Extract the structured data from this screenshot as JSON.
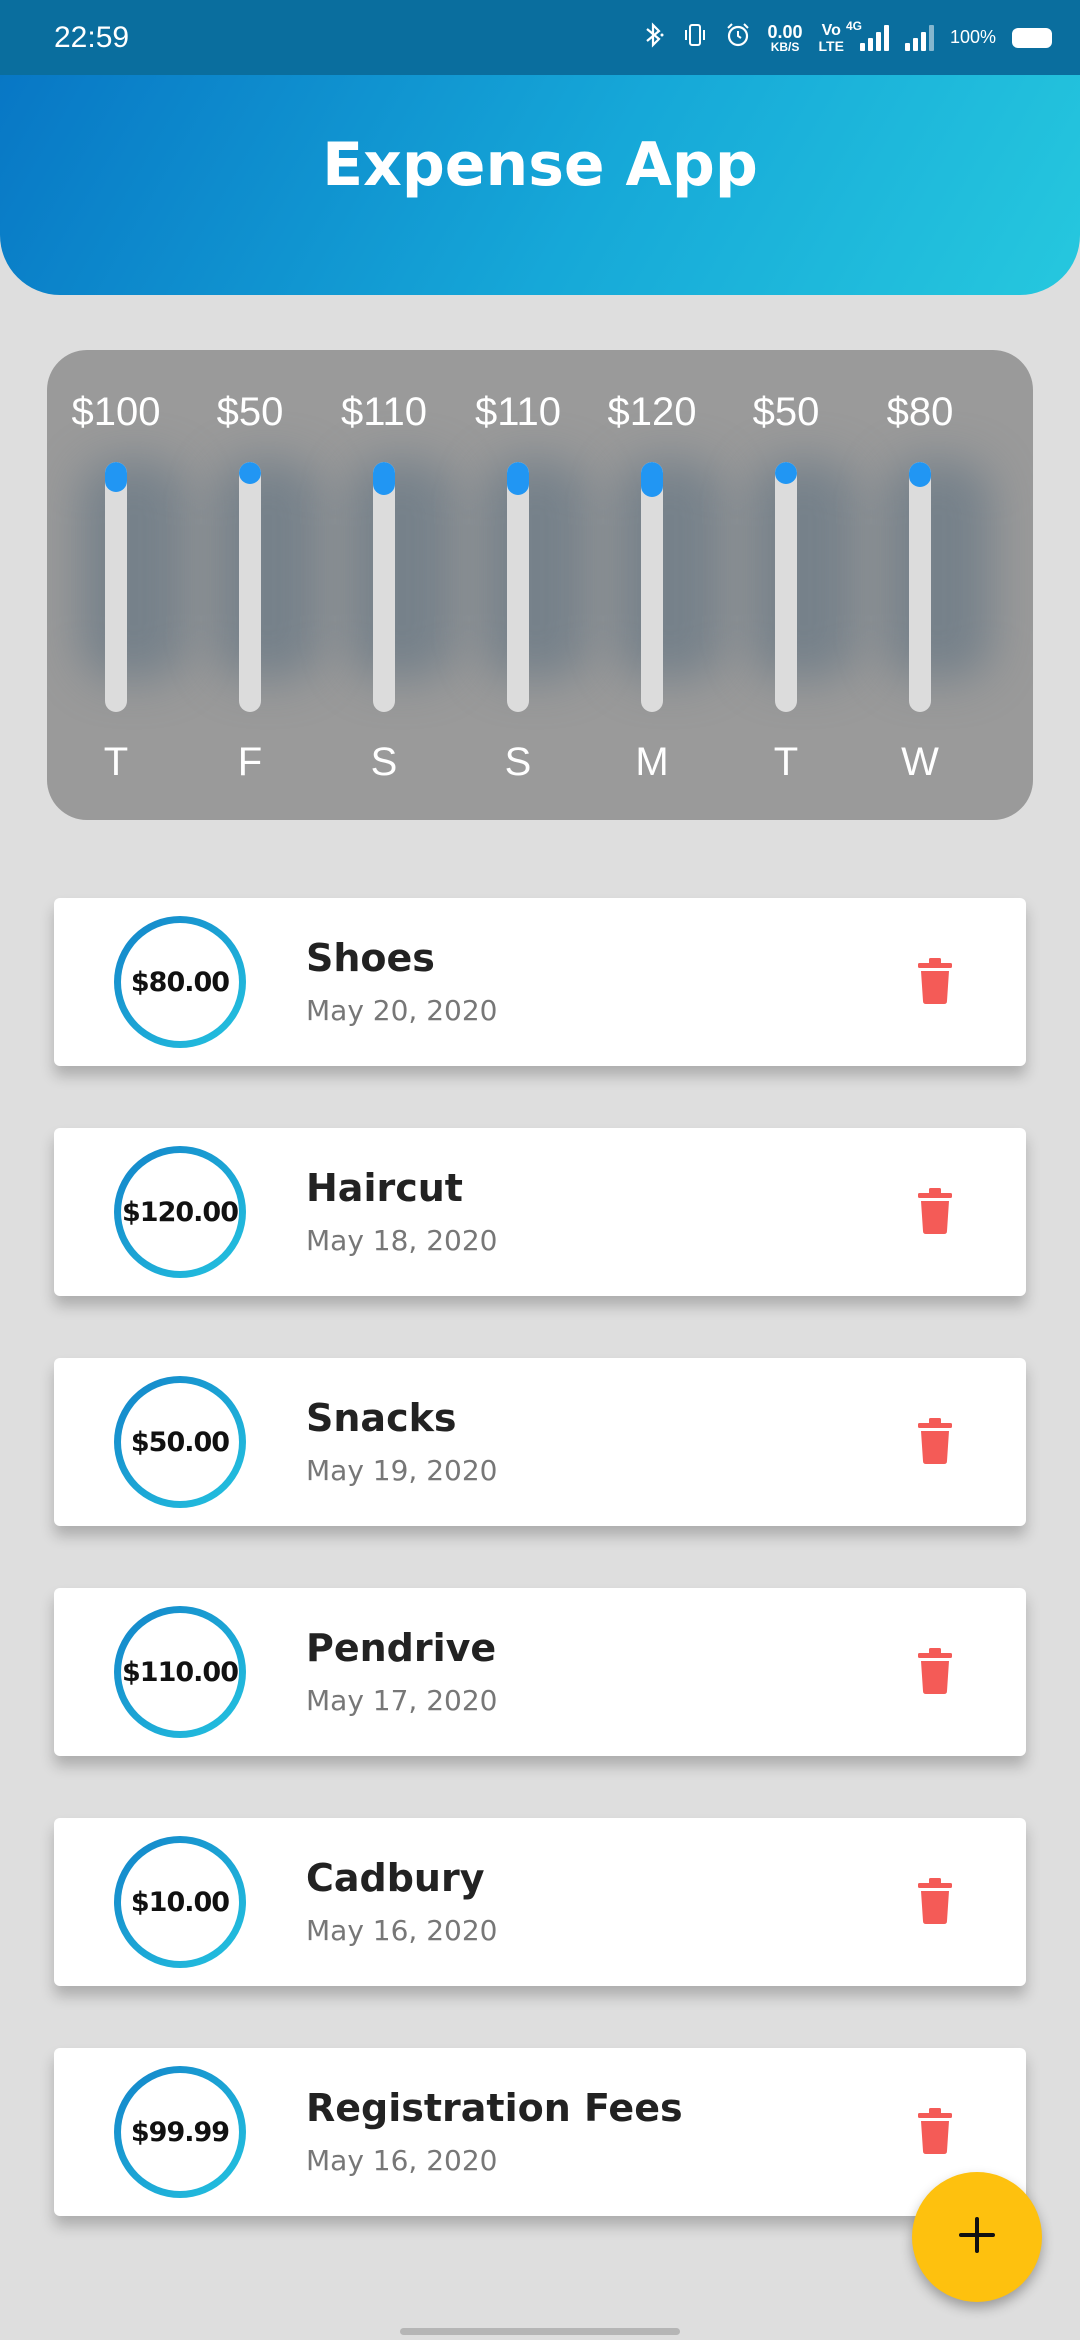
{
  "status_bar": {
    "time": "22:59",
    "net_speed_value": "0.00",
    "net_speed_unit": "KB/S",
    "volte_top": "Vo",
    "volte_bottom": "LTE",
    "network_type": "4G",
    "battery": "100%",
    "icons": [
      "bluetooth-icon",
      "vibrate-icon",
      "alarm-icon",
      "signal-icon",
      "battery-icon"
    ]
  },
  "header": {
    "title": "Expense App"
  },
  "chart": {
    "bars": [
      {
        "amount": "$100",
        "day": "T",
        "fill": 0.12
      },
      {
        "amount": "$50",
        "day": "F",
        "fill": 0.06
      },
      {
        "amount": "$110",
        "day": "S",
        "fill": 0.13
      },
      {
        "amount": "$110",
        "day": "S",
        "fill": 0.13
      },
      {
        "amount": "$120",
        "day": "M",
        "fill": 0.14
      },
      {
        "amount": "$50",
        "day": "T",
        "fill": 0.06
      },
      {
        "amount": "$80",
        "day": "W",
        "fill": 0.1
      }
    ],
    "bar_color": "#2196f3",
    "track_color": "#dcdcdc"
  },
  "expenses": [
    {
      "amount": "$80.00",
      "title": "Shoes",
      "date": "May 20, 2020"
    },
    {
      "amount": "$120.00",
      "title": "Haircut",
      "date": "May 18, 2020"
    },
    {
      "amount": "$50.00",
      "title": "Snacks",
      "date": "May 19, 2020"
    },
    {
      "amount": "$110.00",
      "title": "Pendrive",
      "date": "May 17, 2020"
    },
    {
      "amount": "$10.00",
      "title": "Cadbury",
      "date": "May 16, 2020"
    },
    {
      "amount": "$99.99",
      "title": "Registration Fees",
      "date": "May 16, 2020"
    }
  ],
  "delete_icon": "trash-icon",
  "delete_color": "#f45b57",
  "fab": {
    "icon": "plus-icon",
    "color": "#fec10e"
  }
}
